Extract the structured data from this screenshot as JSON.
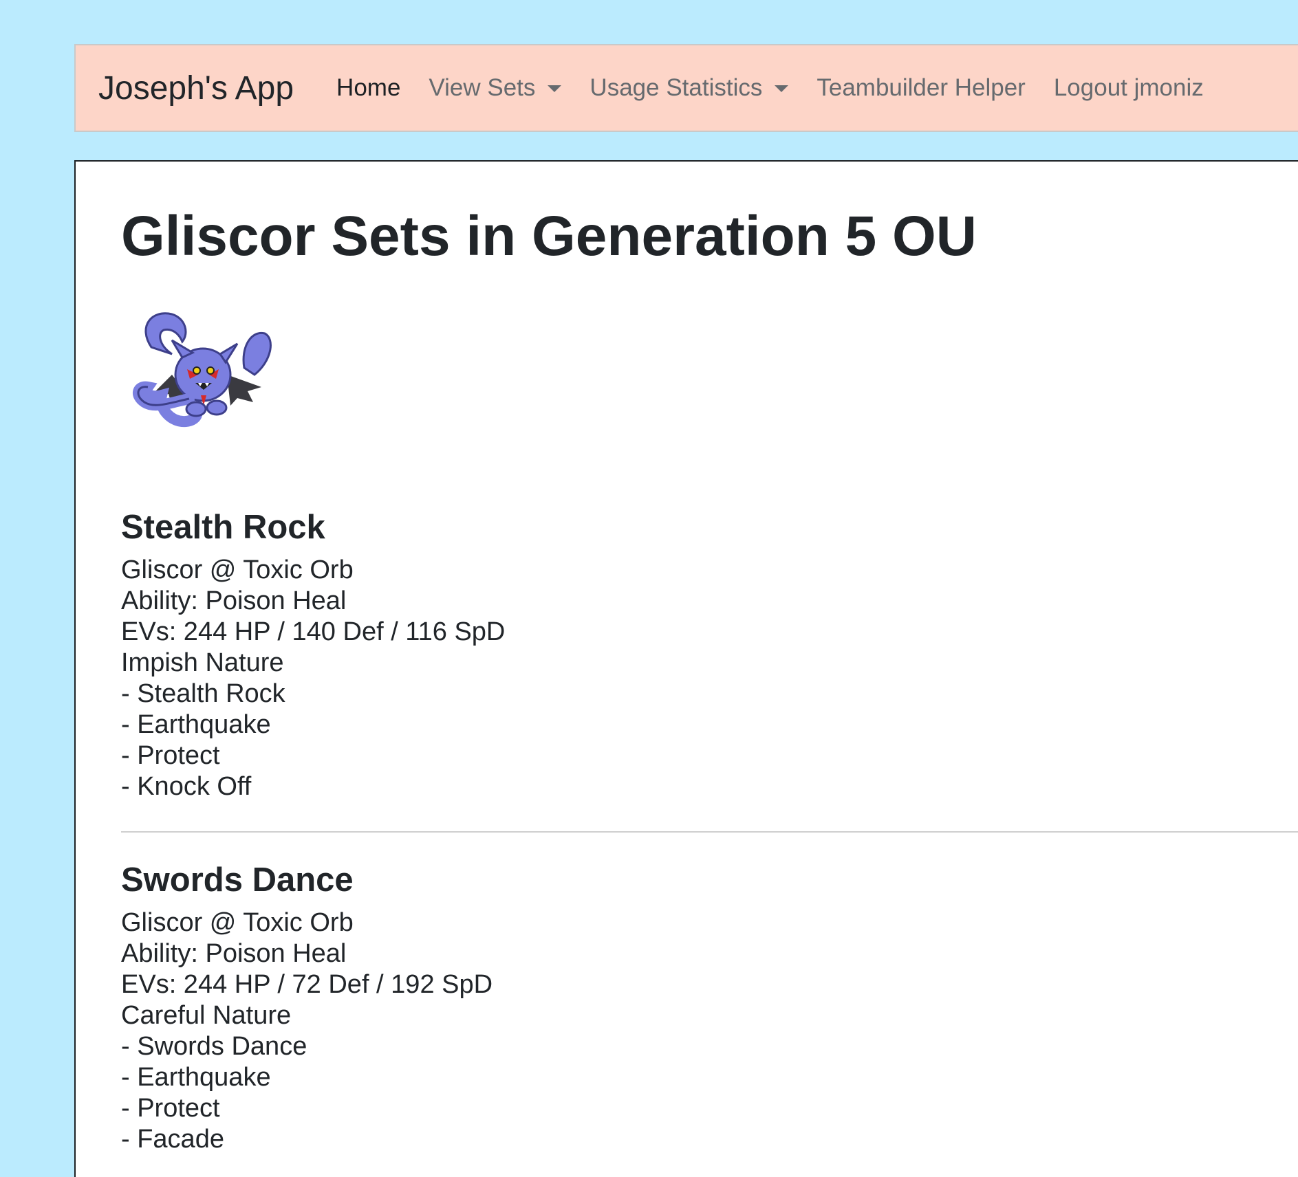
{
  "navbar": {
    "brand": "Joseph's App",
    "items": [
      {
        "label": "Home",
        "active": true,
        "dropdown": false
      },
      {
        "label": "View Sets",
        "active": false,
        "dropdown": true
      },
      {
        "label": "Usage Statistics",
        "active": false,
        "dropdown": true
      },
      {
        "label": "Teambuilder Helper",
        "active": false,
        "dropdown": false
      },
      {
        "label": "Logout jmoniz",
        "active": false,
        "dropdown": false
      }
    ]
  },
  "page": {
    "title": "Gliscor Sets in Generation 5 OU",
    "sprite_icon": "gliscor-sprite"
  },
  "sets": [
    {
      "name": "Stealth Rock",
      "lines": [
        "Gliscor @ Toxic Orb",
        "Ability: Poison Heal",
        "EVs: 244 HP / 140 Def / 116 SpD",
        "Impish Nature",
        "- Stealth Rock",
        "- Earthquake",
        "- Protect",
        "- Knock Off"
      ]
    },
    {
      "name": "Swords Dance",
      "lines": [
        "Gliscor @ Toxic Orb",
        "Ability: Poison Heal",
        "EVs: 244 HP / 72 Def / 192 SpD",
        "Careful Nature",
        "- Swords Dance",
        "- Earthquake",
        "- Protect",
        "- Facade"
      ]
    }
  ],
  "colors": {
    "page_background": "#bbebfe",
    "navbar_background": "#fdd5c8",
    "sprite_body": "#7b7fe0",
    "sprite_wing": "#3a3a40",
    "sprite_accent": "#d62a2a"
  }
}
